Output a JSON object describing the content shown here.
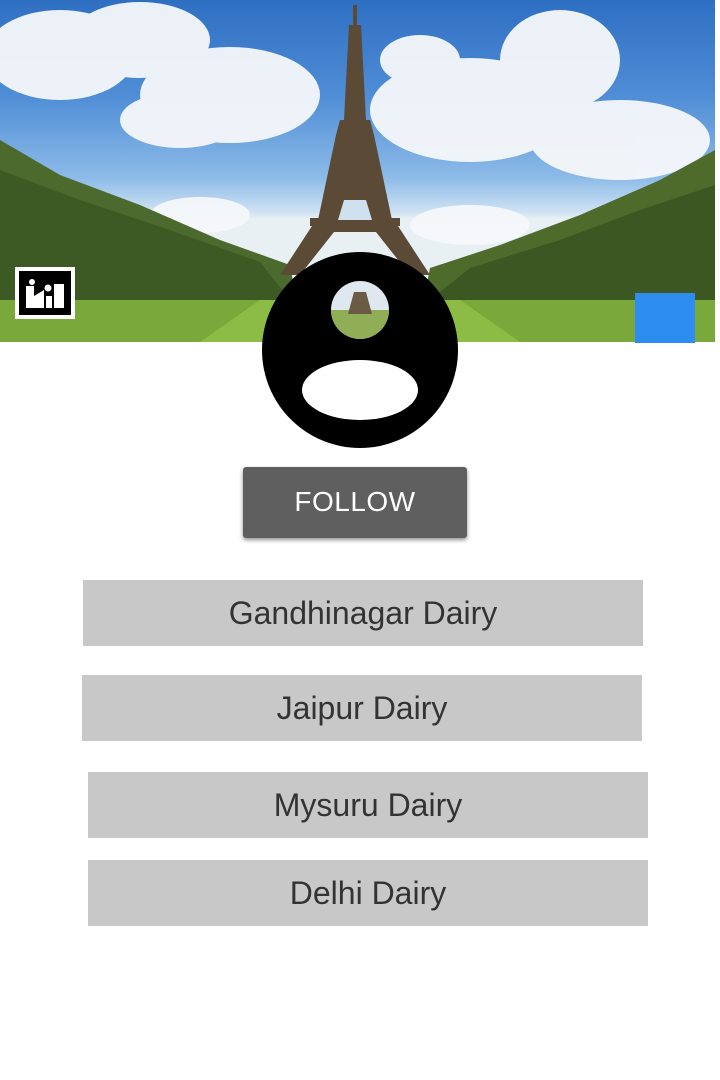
{
  "cover": {
    "image": "eiffel-tower-photo",
    "edit_icon": "image-edit-icon"
  },
  "profile": {
    "avatar_icon": "account-circle-icon",
    "follow_label": "FOLLOW"
  },
  "action_button": {
    "color": "#2d8cf0"
  },
  "dairies": [
    {
      "label": "Gandhinagar Dairy"
    },
    {
      "label": "Jaipur Dairy"
    },
    {
      "label": "Mysuru Dairy"
    },
    {
      "label": "Delhi Dairy"
    }
  ],
  "colors": {
    "follow_bg": "#5f5f5f",
    "list_bg": "#c8c8c8",
    "list_text": "#333333"
  }
}
